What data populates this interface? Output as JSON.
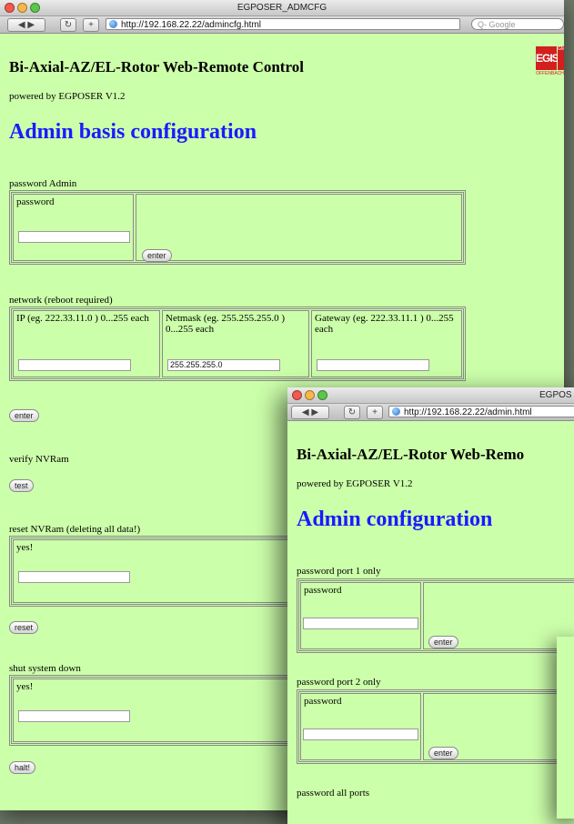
{
  "window1": {
    "title": "EGPOSER_ADMCFG",
    "url": "http://192.168.22.22/admincfg.html",
    "search_placeholder": "Q- Google",
    "app_title": "Bi-Axial-AZ/EL-Rotor Web-Remote Control",
    "powered_by": "powered by EGPOSER V1.2",
    "page_heading": "Admin basis configuration",
    "logo": {
      "main": "EGIS",
      "side": "GMBH",
      "foot": "OFFENBACH"
    },
    "password_section": {
      "label": "password Admin",
      "field_label": "password",
      "field_value": "",
      "button": "enter"
    },
    "network_section": {
      "label": "network (reboot required)",
      "ip_label": "IP (eg. 222.33.11.0 ) 0...255 each",
      "ip_value": "",
      "netmask_label": "Netmask (eg. 255.255.255.0 ) 0...255 each",
      "netmask_value": "255.255.255.0",
      "gateway_label": "Gateway (eg. 222.33.11.1 ) 0...255 each",
      "gateway_value": "",
      "button": "enter"
    },
    "verify_section": {
      "label": "verify NVRam",
      "button": "test"
    },
    "reset_section": {
      "label": "reset NVRam (deleting all data!)",
      "field_label": "yes!",
      "field_value": "",
      "button": "reset"
    },
    "shutdown_section": {
      "label": "shut system down",
      "field_label": "yes!",
      "field_value": "",
      "button": "halt!"
    }
  },
  "window2": {
    "title": "EGPOS",
    "url": "http://192.168.22.22/admin.html",
    "app_title": "Bi-Axial-AZ/EL-Rotor Web-Remo",
    "powered_by": "powered by EGPOSER V1.2",
    "page_heading": "Admin configuration",
    "port1": {
      "label": "password port 1 only",
      "field_label": "password",
      "field_value": "",
      "button": "enter"
    },
    "port2": {
      "label": "password port 2 only",
      "field_label": "password",
      "field_value": "",
      "button": "enter"
    },
    "all_ports_label": "password all ports"
  },
  "colors": {
    "page_bg": "#ccffaa",
    "heading": "#1a1aff",
    "logo": "#d21f1f"
  },
  "icons": [
    "back-icon",
    "forward-icon",
    "reload-icon",
    "add-bookmark-icon",
    "globe-icon",
    "search-icon"
  ]
}
